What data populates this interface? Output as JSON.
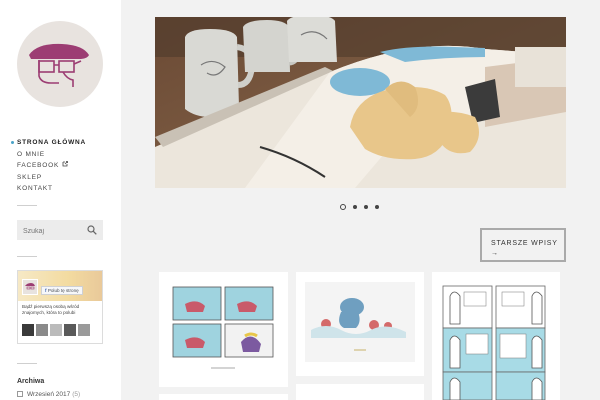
{
  "nav": {
    "items": [
      {
        "label": "STRONA GŁÓWNA",
        "active": true
      },
      {
        "label": "O MNIE"
      },
      {
        "label": "FACEBOOK"
      },
      {
        "label": "SKLEP"
      },
      {
        "label": "KONTAKT"
      }
    ]
  },
  "search": {
    "placeholder": "Szukaj"
  },
  "facebook_widget": {
    "like_button": "Polub tę stronę",
    "text": "Bądź pierwszą osobą wśród znajomych, która to polubi"
  },
  "archive": {
    "title": "Archiwa",
    "items": [
      {
        "label": "Wrzesień 2017",
        "count": "(5)"
      }
    ]
  },
  "slider": {
    "slide_count": 4,
    "active_index": 0
  },
  "pagination": {
    "older_label": "STARSZE WPISY",
    "older_arrow": "→"
  },
  "colors": {
    "accent": "#4aa3c8",
    "logo_hat": "#9c3d73",
    "background": "#f2f2f2"
  }
}
